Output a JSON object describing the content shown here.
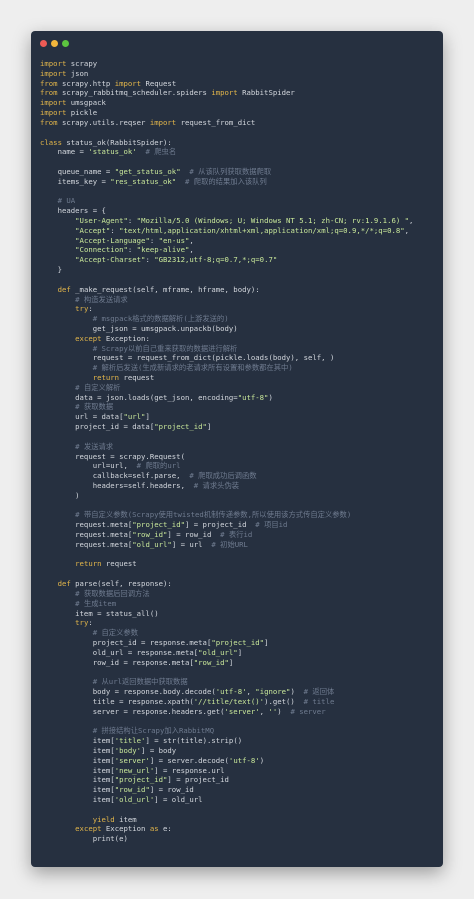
{
  "window": {
    "buttons": {
      "close_color": "#ed5b55",
      "minimize_color": "#f2b63c",
      "zoom_color": "#5cc43f"
    }
  },
  "colors": {
    "background": "#263040",
    "keyword": "#e3b64a",
    "string": "#c9e89a",
    "comment": "#6f7b8f",
    "text": "#d4d8de"
  },
  "code_lines": [
    [
      [
        "kw",
        "import"
      ],
      [
        "pl",
        " scrapy"
      ]
    ],
    [
      [
        "kw",
        "import"
      ],
      [
        "pl",
        " json"
      ]
    ],
    [
      [
        "kw",
        "from"
      ],
      [
        "pl",
        " scrapy.http "
      ],
      [
        "kw",
        "import"
      ],
      [
        "pl",
        " Request"
      ]
    ],
    [
      [
        "kw",
        "from"
      ],
      [
        "pl",
        " scrapy_rabbitmq_scheduler.spiders "
      ],
      [
        "kw",
        "import"
      ],
      [
        "pl",
        " RabbitSpider"
      ]
    ],
    [
      [
        "kw",
        "import"
      ],
      [
        "pl",
        " umsgpack"
      ]
    ],
    [
      [
        "kw",
        "import"
      ],
      [
        "pl",
        " pickle"
      ]
    ],
    [
      [
        "kw",
        "from"
      ],
      [
        "pl",
        " scrapy.utils.reqser "
      ],
      [
        "kw",
        "import"
      ],
      [
        "pl",
        " request_from_dict"
      ]
    ],
    [],
    [
      [
        "kw",
        "class"
      ],
      [
        "pl",
        " status_ok(RabbitSpider):"
      ]
    ],
    [
      [
        "pl",
        "    name = "
      ],
      [
        "str",
        "'status_ok'"
      ],
      [
        "pl",
        "  "
      ],
      [
        "cm",
        "# 爬虫名"
      ]
    ],
    [],
    [
      [
        "pl",
        "    queue_name = "
      ],
      [
        "str",
        "\"get_status_ok\""
      ],
      [
        "pl",
        "  "
      ],
      [
        "cm",
        "# 从该队列获取数据爬取"
      ]
    ],
    [
      [
        "pl",
        "    items_key = "
      ],
      [
        "str",
        "\"res_status_ok\""
      ],
      [
        "pl",
        "  "
      ],
      [
        "cm",
        "# 爬取的结果加入该队列"
      ]
    ],
    [],
    [
      [
        "pl",
        "    "
      ],
      [
        "cm",
        "# UA"
      ]
    ],
    [
      [
        "pl",
        "    headers = {"
      ]
    ],
    [
      [
        "pl",
        "        "
      ],
      [
        "str",
        "\"User-Agent\""
      ],
      [
        "pl",
        ": "
      ],
      [
        "str",
        "\"Mozilla/5.0 (Windows; U; Windows NT 5.1; zh-CN; rv:1.9.1.6) \""
      ],
      [
        "pl",
        ","
      ]
    ],
    [
      [
        "pl",
        "        "
      ],
      [
        "str",
        "\"Accept\""
      ],
      [
        "pl",
        ": "
      ],
      [
        "str",
        "\"text/html,application/xhtml+xml,application/xml;q=0.9,*/*;q=0.8\""
      ],
      [
        "pl",
        ","
      ]
    ],
    [
      [
        "pl",
        "        "
      ],
      [
        "str",
        "\"Accept-Language\""
      ],
      [
        "pl",
        ": "
      ],
      [
        "str",
        "\"en-us\""
      ],
      [
        "pl",
        ","
      ]
    ],
    [
      [
        "pl",
        "        "
      ],
      [
        "str",
        "\"Connection\""
      ],
      [
        "pl",
        ": "
      ],
      [
        "str",
        "\"keep-alive\""
      ],
      [
        "pl",
        ","
      ]
    ],
    [
      [
        "pl",
        "        "
      ],
      [
        "str",
        "\"Accept-Charset\""
      ],
      [
        "pl",
        ": "
      ],
      [
        "str",
        "\"GB2312,utf-8;q=0.7,*;q=0.7\""
      ]
    ],
    [
      [
        "pl",
        "    }"
      ]
    ],
    [],
    [
      [
        "pl",
        "    "
      ],
      [
        "kw",
        "def"
      ],
      [
        "pl",
        " _make_request(self, mframe, hframe, body):"
      ]
    ],
    [
      [
        "pl",
        "        "
      ],
      [
        "cm",
        "# 构造发送请求"
      ]
    ],
    [
      [
        "pl",
        "        "
      ],
      [
        "kw",
        "try"
      ],
      [
        "pl",
        ":"
      ]
    ],
    [
      [
        "pl",
        "            "
      ],
      [
        "cm",
        "# msgpack格式的数据解析(上游发送的)"
      ]
    ],
    [
      [
        "pl",
        "            get_json = umsgpack.unpackb(body)"
      ]
    ],
    [
      [
        "pl",
        "        "
      ],
      [
        "kw",
        "except"
      ],
      [
        "pl",
        " Exception:"
      ]
    ],
    [
      [
        "pl",
        "            "
      ],
      [
        "cm",
        "# Scrapy以前自己重来获取的数据进行解析"
      ]
    ],
    [
      [
        "pl",
        "            request = request_from_dict(pickle.loads(body), self, )"
      ]
    ],
    [
      [
        "pl",
        "            "
      ],
      [
        "cm",
        "# 解析后发送(生成新请求的老请求所有设置和参数都在其中)"
      ]
    ],
    [
      [
        "pl",
        "            "
      ],
      [
        "kw",
        "return"
      ],
      [
        "pl",
        " request"
      ]
    ],
    [
      [
        "pl",
        "        "
      ],
      [
        "cm",
        "# 自定义解析"
      ]
    ],
    [
      [
        "pl",
        "        data = json.loads(get_json, encoding="
      ],
      [
        "str",
        "\"utf-8\""
      ],
      [
        "pl",
        ")"
      ]
    ],
    [
      [
        "pl",
        "        "
      ],
      [
        "cm",
        "# 获取数据"
      ]
    ],
    [
      [
        "pl",
        "        url = data["
      ],
      [
        "str",
        "\"url\""
      ],
      [
        "pl",
        "]"
      ]
    ],
    [
      [
        "pl",
        "        project_id = data["
      ],
      [
        "str",
        "\"project_id\""
      ],
      [
        "pl",
        "]"
      ]
    ],
    [],
    [
      [
        "pl",
        "        "
      ],
      [
        "cm",
        "# 发送请求"
      ]
    ],
    [
      [
        "pl",
        "        request = scrapy.Request("
      ]
    ],
    [
      [
        "pl",
        "            url=url,  "
      ],
      [
        "cm",
        "# 爬取的url"
      ]
    ],
    [
      [
        "pl",
        "            callback=self.parse,  "
      ],
      [
        "cm",
        "# 爬取成功后调函数"
      ]
    ],
    [
      [
        "pl",
        "            headers=self.headers,  "
      ],
      [
        "cm",
        "# 请求头伪装"
      ]
    ],
    [
      [
        "pl",
        "        )"
      ]
    ],
    [],
    [
      [
        "pl",
        "        "
      ],
      [
        "cm",
        "# 带自定义参数(Scrapy使用twisted机制传递参数,所以使用该方式传自定义参数)"
      ]
    ],
    [
      [
        "pl",
        "        request.meta["
      ],
      [
        "str",
        "\"project_id\""
      ],
      [
        "pl",
        "] = project_id  "
      ],
      [
        "cm",
        "# 项目id"
      ]
    ],
    [
      [
        "pl",
        "        request.meta["
      ],
      [
        "str",
        "\"row_id\""
      ],
      [
        "pl",
        "] = row_id  "
      ],
      [
        "cm",
        "# 表行id"
      ]
    ],
    [
      [
        "pl",
        "        request.meta["
      ],
      [
        "str",
        "\"old_url\""
      ],
      [
        "pl",
        "] = url  "
      ],
      [
        "cm",
        "# 初始URL"
      ]
    ],
    [],
    [
      [
        "pl",
        "        "
      ],
      [
        "kw",
        "return"
      ],
      [
        "pl",
        " request"
      ]
    ],
    [],
    [
      [
        "pl",
        "    "
      ],
      [
        "kw",
        "def"
      ],
      [
        "pl",
        " parse(self, response):"
      ]
    ],
    [
      [
        "pl",
        "        "
      ],
      [
        "cm",
        "# 获取数据后回调方法"
      ]
    ],
    [
      [
        "pl",
        "        "
      ],
      [
        "cm",
        "# 生成item"
      ]
    ],
    [
      [
        "pl",
        "        item = status_all()"
      ]
    ],
    [
      [
        "pl",
        "        "
      ],
      [
        "kw",
        "try"
      ],
      [
        "pl",
        ":"
      ]
    ],
    [
      [
        "pl",
        "            "
      ],
      [
        "cm",
        "# 自定义参数"
      ]
    ],
    [
      [
        "pl",
        "            project_id = response.meta["
      ],
      [
        "str",
        "\"project_id\""
      ],
      [
        "pl",
        "]"
      ]
    ],
    [
      [
        "pl",
        "            old_url = response.meta["
      ],
      [
        "str",
        "\"old_url\""
      ],
      [
        "pl",
        "]"
      ]
    ],
    [
      [
        "pl",
        "            row_id = response.meta["
      ],
      [
        "str",
        "\"row_id\""
      ],
      [
        "pl",
        "]"
      ]
    ],
    [],
    [
      [
        "pl",
        "            "
      ],
      [
        "cm",
        "# 从url返回数据中获取数据"
      ]
    ],
    [
      [
        "pl",
        "            body = response.body.decode("
      ],
      [
        "str",
        "'utf-8'"
      ],
      [
        "pl",
        ", "
      ],
      [
        "str",
        "\"ignore\""
      ],
      [
        "pl",
        ")  "
      ],
      [
        "cm",
        "# 返回体"
      ]
    ],
    [
      [
        "pl",
        "            title = response.xpath("
      ],
      [
        "str",
        "'//title/text()'"
      ],
      [
        "pl",
        ").get()  "
      ],
      [
        "cm",
        "# title"
      ]
    ],
    [
      [
        "pl",
        "            server = response.headers.get("
      ],
      [
        "str",
        "'server'"
      ],
      [
        "pl",
        ", "
      ],
      [
        "str",
        "''"
      ],
      [
        "pl",
        ")  "
      ],
      [
        "cm",
        "# server"
      ]
    ],
    [],
    [
      [
        "pl",
        "            "
      ],
      [
        "cm",
        "# 拼接结构让Scrapy加入RabbitMQ"
      ]
    ],
    [
      [
        "pl",
        "            item["
      ],
      [
        "str",
        "'title'"
      ],
      [
        "pl",
        "] = str(title).strip()"
      ]
    ],
    [
      [
        "pl",
        "            item["
      ],
      [
        "str",
        "'body'"
      ],
      [
        "pl",
        "] = body"
      ]
    ],
    [
      [
        "pl",
        "            item["
      ],
      [
        "str",
        "'server'"
      ],
      [
        "pl",
        "] = server.decode("
      ],
      [
        "str",
        "'utf-8'"
      ],
      [
        "pl",
        ")"
      ]
    ],
    [
      [
        "pl",
        "            item["
      ],
      [
        "str",
        "'new_url'"
      ],
      [
        "pl",
        "] = response.url"
      ]
    ],
    [
      [
        "pl",
        "            item["
      ],
      [
        "str",
        "\"project_id\""
      ],
      [
        "pl",
        "] = project_id"
      ]
    ],
    [
      [
        "pl",
        "            item["
      ],
      [
        "str",
        "\"row_id\""
      ],
      [
        "pl",
        "] = row_id"
      ]
    ],
    [
      [
        "pl",
        "            item["
      ],
      [
        "str",
        "'old_url'"
      ],
      [
        "pl",
        "] = old_url"
      ]
    ],
    [],
    [
      [
        "pl",
        "            "
      ],
      [
        "kw",
        "yield"
      ],
      [
        "pl",
        " item"
      ]
    ],
    [
      [
        "pl",
        "        "
      ],
      [
        "kw",
        "except"
      ],
      [
        "pl",
        " Exception "
      ],
      [
        "kw",
        "as"
      ],
      [
        "pl",
        " e:"
      ]
    ],
    [
      [
        "pl",
        "            print(e)"
      ]
    ]
  ]
}
